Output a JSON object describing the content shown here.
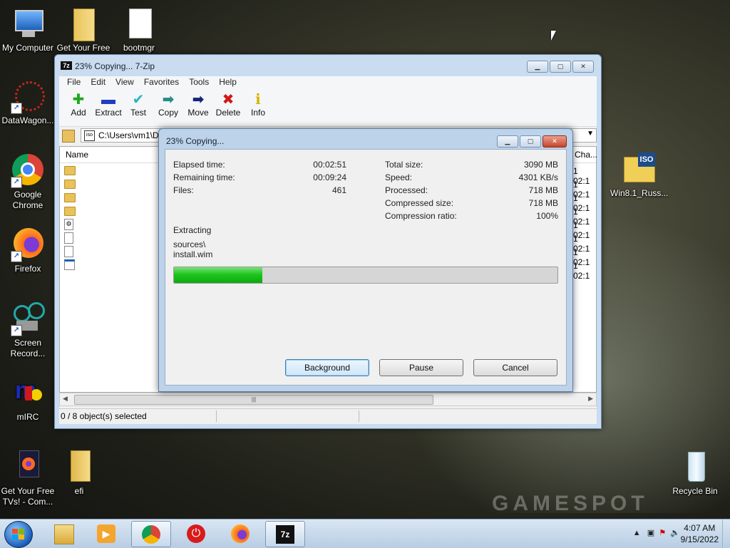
{
  "desktop": {
    "icons": [
      {
        "label": "My Computer"
      },
      {
        "label": "Get Your Free"
      },
      {
        "label": "bootmgr"
      },
      {
        "label": "DataWagon..."
      },
      {
        "label": "Google Chrome"
      },
      {
        "label": "Firefox"
      },
      {
        "label": "Screen Record..."
      },
      {
        "label": "mIRC"
      },
      {
        "label": "Get Your Free TVs! - Com..."
      },
      {
        "label": "efi"
      },
      {
        "label": "Win8.1_Russ..."
      },
      {
        "label": "Recycle Bin"
      }
    ],
    "watermark": "GAMESPOT"
  },
  "window": {
    "title": "23% Copying... 7-Zip",
    "app_icon": "7z",
    "menu": [
      "File",
      "Edit",
      "View",
      "Favorites",
      "Tools",
      "Help"
    ],
    "toolbar": [
      {
        "label": "Add",
        "icon": "plus-icon",
        "color": "#1fa81f",
        "glyph": "✚"
      },
      {
        "label": "Extract",
        "icon": "minus-icon",
        "color": "#1f3fbf",
        "glyph": "▬"
      },
      {
        "label": "Test",
        "icon": "check-icon",
        "color": "#2bb3c9",
        "glyph": "✔"
      },
      {
        "label": "Copy",
        "icon": "copy-arrow-icon",
        "color": "#2a8a8a",
        "glyph": "➡"
      },
      {
        "label": "Move",
        "icon": "move-arrow-icon",
        "color": "#14237a",
        "glyph": "➡"
      },
      {
        "label": "Delete",
        "icon": "delete-icon",
        "color": "#d01818",
        "glyph": "✖"
      },
      {
        "label": "Info",
        "icon": "info-icon",
        "color": "#d9b300",
        "glyph": "ℹ"
      }
    ],
    "address": "C:\\Users\\vm1\\D",
    "list": {
      "col_name": "Name",
      "col_changed": "Cha...",
      "rows": [
        {
          "type": "folder",
          "date": "1 02:1"
        },
        {
          "type": "folder",
          "date": "1 02:1"
        },
        {
          "type": "folder",
          "date": "1 02:1"
        },
        {
          "type": "folder",
          "date": "1 02:1"
        },
        {
          "type": "settings-file",
          "date": "1 02:1"
        },
        {
          "type": "file",
          "date": "1 02:1"
        },
        {
          "type": "file",
          "date": "1 02:1"
        },
        {
          "type": "exe-file",
          "date": "1 02:1"
        }
      ]
    },
    "status": "0 / 8 object(s) selected"
  },
  "dialog": {
    "title": "23% Copying...",
    "elapsed_label": "Elapsed time:",
    "elapsed_value": "00:02:51",
    "remaining_label": "Remaining time:",
    "remaining_value": "00:09:24",
    "files_label": "Files:",
    "files_value": "461",
    "total_label": "Total size:",
    "total_value": "3090 MB",
    "speed_label": "Speed:",
    "speed_value": "4301 KB/s",
    "processed_label": "Processed:",
    "processed_value": "718 MB",
    "compressed_label": "Compressed size:",
    "compressed_value": "718 MB",
    "ratio_label": "Compression ratio:",
    "ratio_value": "100%",
    "action": "Extracting",
    "path_line1": "sources\\",
    "path_line2": "install.wim",
    "progress": 0.23,
    "buttons": {
      "background": "Background",
      "pause": "Pause",
      "cancel": "Cancel"
    }
  },
  "taskbar": {
    "apps": [
      "windows-explorer",
      "media-player",
      "chrome",
      "power",
      "firefox",
      "7-zip"
    ],
    "time": "4:07 AM",
    "date": "9/15/2022"
  }
}
